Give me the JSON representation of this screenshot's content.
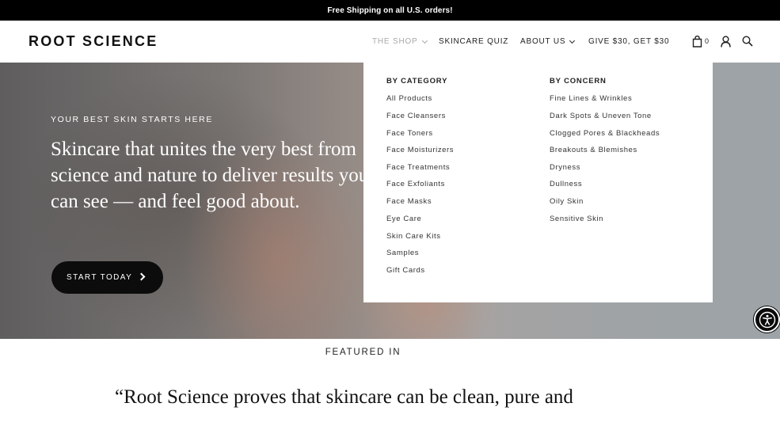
{
  "announcement": {
    "text": "Free Shipping on all U.S. orders!"
  },
  "header": {
    "logo": "ROOT SCIENCE",
    "nav": {
      "shop": "THE SHOP",
      "quiz": "SKINCARE QUIZ",
      "about": "ABOUT US",
      "referral": "GIVE $30, GET $30"
    },
    "cart_count": "0"
  },
  "hero": {
    "eyebrow": "YOUR BEST SKIN STARTS HERE",
    "headline": "Skincare that unites the very best from science and nature to deliver results you can see — and feel good about.",
    "cta_label": "START TODAY"
  },
  "menu": {
    "category_heading": "BY CATEGORY",
    "categories": [
      "All Products",
      "Face Cleansers",
      "Face Toners",
      "Face Moisturizers",
      "Face Treatments",
      "Face Exfoliants",
      "Face Masks",
      "Eye Care",
      "Skin Care Kits",
      "Samples",
      "Gift Cards"
    ],
    "concern_heading": "BY CONCERN",
    "concerns": [
      "Fine Lines & Wrinkles",
      "Dark Spots & Uneven Tone",
      "Clogged Pores & Blackheads",
      "Breakouts & Blemishes",
      "Dryness",
      "Dullness",
      "Oily Skin",
      "Sensitive Skin"
    ]
  },
  "featured": {
    "heading": "FEATURED IN",
    "quote": "“Root Science proves that skincare can be clean, pure and"
  },
  "colors": {
    "announcement_bg": "#000000",
    "cta_bg": "#0c0c0c",
    "active_nav": "#a8a8a8"
  },
  "icons": [
    "bag-icon",
    "account-icon",
    "search-icon",
    "chevron-right-icon",
    "accessibility-icon"
  ]
}
